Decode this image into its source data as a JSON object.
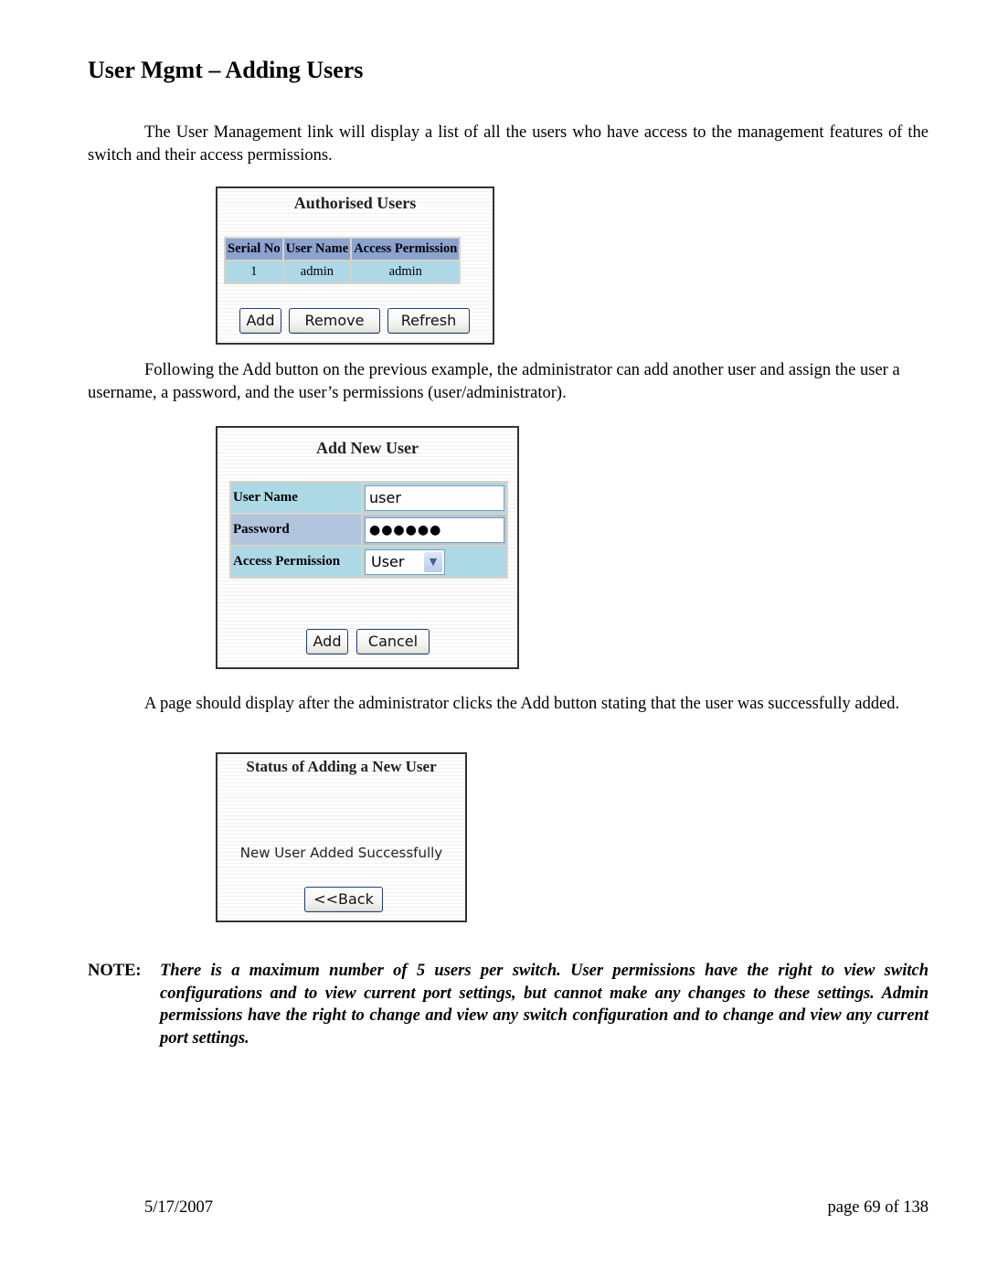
{
  "title": "User Mgmt – Adding Users",
  "paragraphs": {
    "intro": "The User Management link will display a list of all the users who have access to the management features of the switch and their access permissions.",
    "add_instructions": "Following the Add button on the previous example, the administrator can add another user and assign the user a username, a password, and the user’s permissions (user/administrator).",
    "status_instructions": "A page should display after the administrator clicks the Add button stating that the user was successfully added."
  },
  "authorised_users_panel": {
    "title": "Authorised Users",
    "columns": [
      "Serial No",
      "User Name",
      "Access Permission"
    ],
    "rows": [
      {
        "serial_no": "1",
        "user_name": "admin",
        "access_permission": "admin"
      }
    ],
    "buttons": {
      "add": "Add",
      "remove": "Remove",
      "refresh": "Refresh"
    },
    "colors": {
      "header_bg": "#8ba3cf",
      "row_bg": "#add8e6"
    }
  },
  "add_user_panel": {
    "title": "Add New User",
    "fields": {
      "user_name": {
        "label": "User Name",
        "value": "user"
      },
      "password": {
        "label": "Password",
        "value": "●●●●●●"
      },
      "access_permission": {
        "label": "Access Permission",
        "selected": "User"
      }
    },
    "buttons": {
      "add": "Add",
      "cancel": "Cancel"
    }
  },
  "status_panel": {
    "title": "Status of Adding a New User",
    "message": "New User Added Successfully",
    "back_button": "<<Back"
  },
  "note": {
    "label": "NOTE:",
    "text": "There is a maximum number of 5 users per switch.  User permissions have the right to view switch configurations and to view current port settings, but cannot make any changes to these settings.  Admin permissions have the right to change and view any switch configuration and to change and view any current port settings."
  },
  "footer": {
    "date": "5/17/2007",
    "page": "page 69 of 138"
  }
}
